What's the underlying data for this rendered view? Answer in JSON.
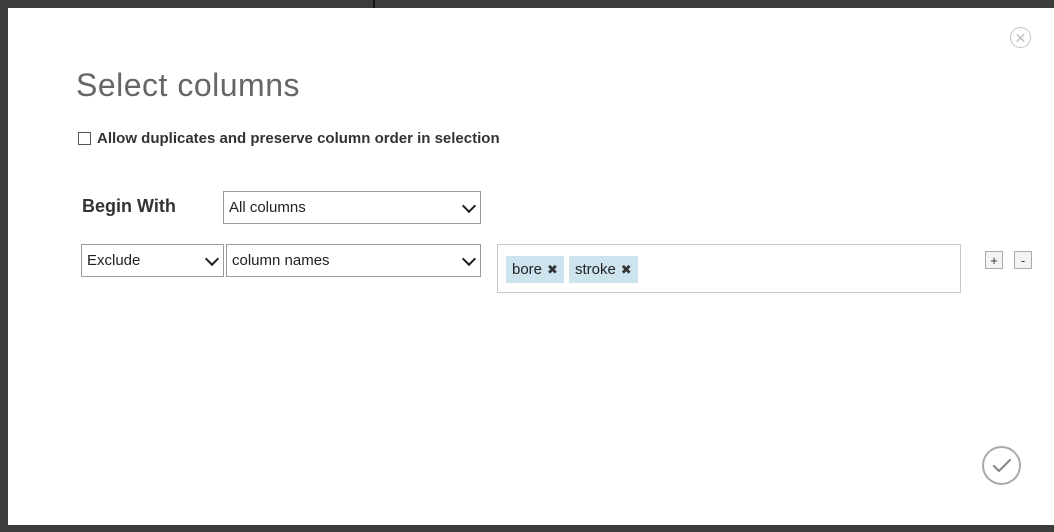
{
  "dialog": {
    "title": "Select columns",
    "close_icon": "close-icon",
    "confirm_icon": "checkmark-icon"
  },
  "options": {
    "allow_duplicates_label": "Allow duplicates and preserve column order in selection",
    "allow_duplicates_checked": false
  },
  "begin_with": {
    "label": "Begin With",
    "value": "All columns"
  },
  "rule": {
    "mode": "Exclude",
    "type": "column names",
    "tags": [
      {
        "label": "bore"
      },
      {
        "label": "stroke"
      }
    ],
    "add_label": "+",
    "remove_label": "-"
  }
}
